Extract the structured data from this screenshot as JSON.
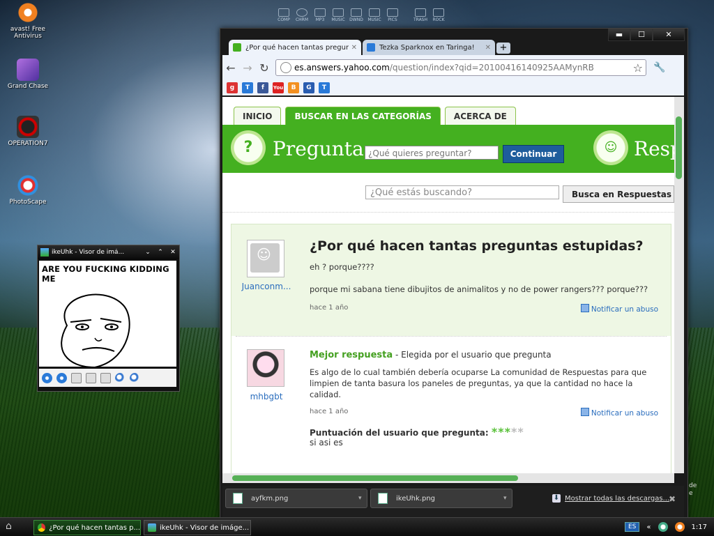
{
  "desktop": {
    "icons": [
      {
        "name": "avast",
        "label": "avast! Free Antivirus"
      },
      {
        "name": "grand-chase",
        "label": "Grand Chase"
      },
      {
        "name": "operation7",
        "label": "OPERATION7"
      },
      {
        "name": "photoscape",
        "label": "PhotoScape"
      }
    ],
    "dock": [
      "COMP",
      "CHRM",
      "MP3",
      "MUSIC",
      "DWND",
      "MUSIC",
      "PICS",
      "TRASH",
      "ROCK"
    ],
    "side_text": "de\ne"
  },
  "viewer": {
    "title": "ikeUhk - Visor de imá...",
    "meme_text": "ARE YOU FUCKING KIDDING ME",
    "controls": {
      "min": "⌄",
      "restore": "⌃",
      "close": "✕"
    }
  },
  "browser": {
    "window_buttons": {
      "minimize": "▬",
      "maximize": "☐",
      "close": "✕"
    },
    "tabs": [
      {
        "label": "¿Por qué hacen tantas preguntas e",
        "active": true,
        "icon_color": "#44b020"
      },
      {
        "label": "Tezka Sparknox en Taringa!",
        "active": false,
        "icon_color": "#2a7ad8"
      }
    ],
    "new_tab": "+",
    "nav": {
      "back": "←",
      "forward": "→",
      "reload": "↻"
    },
    "url": {
      "host": "es.answers.yahoo.com",
      "path": "/question/index?qid=20100416140925AAMynRB"
    },
    "bookmarks": [
      {
        "icon": "google-icon",
        "text": "g",
        "color": "#d33"
      },
      {
        "icon": "taringa-icon",
        "text": "T",
        "color": "#2a7ad8"
      },
      {
        "icon": "facebook-icon",
        "text": "f",
        "color": "#3b5998"
      },
      {
        "icon": "youtube-icon",
        "text": "You",
        "color": "#d22"
      },
      {
        "icon": "blogger-icon",
        "text": "B",
        "color": "#f39020"
      },
      {
        "icon": "gmail-icon",
        "text": "G",
        "color": "#2a5db0"
      },
      {
        "icon": "taringa-icon",
        "text": "T",
        "color": "#2a7ad8"
      }
    ]
  },
  "page": {
    "tabs": [
      {
        "label": "INICIO",
        "active": false
      },
      {
        "label": "BUSCAR EN LAS CATEGORÍAS",
        "active": true
      },
      {
        "label": "ACERCA DE",
        "active": false
      }
    ],
    "banner": {
      "pregunta_label": "Pregunta",
      "ask_placeholder": "¿Qué quieres preguntar?",
      "continue_button": "Continuar",
      "respond_label": "Resp"
    },
    "search": {
      "placeholder": "¿Qué estás buscando?",
      "button": "Busca en Respuestas"
    },
    "question": {
      "asker": "Juanconm...",
      "title": "¿Por qué hacen tantas preguntas estupidas?",
      "line1": "eh ? porque????",
      "line2": "porque mi sabana tiene dibujitos de animalitos y no de power rangers??? porque???",
      "time": "hace 1 año",
      "report": "Notificar un abuso"
    },
    "best_answer": {
      "author": "mhbgbt",
      "label": "Mejor respuesta",
      "chosen_by": " - Elegida por el usuario que pregunta",
      "text": "Es algo de lo cual también debería ocuparse La comunidad de Respuestas para que limpien de tanta basura los paneles de preguntas, ya que la cantidad no hace la calidad.",
      "time": "hace 1 año",
      "report": "Notificar un abuso",
      "rating_label": "Puntuación del usuario que pregunta:",
      "rating": 3,
      "rating_max": 5,
      "comment": "si asi es"
    }
  },
  "downloads": {
    "items": [
      {
        "name": "ayfkm.png"
      },
      {
        "name": "ikeUhk.png"
      }
    ],
    "show_all": "Mostrar todas las descargas...",
    "close": "✖"
  },
  "taskbar": {
    "tasks": [
      {
        "label": "¿Por qué hacen tantas p...",
        "active": true
      },
      {
        "label": "ikeUhk - Visor de imáge...",
        "active": false
      }
    ],
    "language": "ES",
    "tray_arrows": "«",
    "clock": "1:17"
  }
}
